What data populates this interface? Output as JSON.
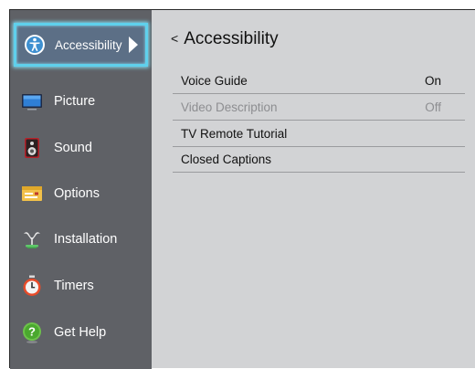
{
  "sidebar": {
    "items": [
      {
        "label": "Accessibility",
        "icon": "accessibility-icon",
        "selected": true
      },
      {
        "label": "Picture",
        "icon": "tv-screen-icon"
      },
      {
        "label": "Sound",
        "icon": "speaker-icon"
      },
      {
        "label": "Options",
        "icon": "options-icon"
      },
      {
        "label": "Installation",
        "icon": "antenna-icon"
      },
      {
        "label": "Timers",
        "icon": "stopwatch-icon"
      },
      {
        "label": "Get Help",
        "icon": "help-icon"
      }
    ]
  },
  "content": {
    "back_glyph": "<",
    "title": "Accessibility",
    "rows": [
      {
        "label": "Voice Guide",
        "value": "On"
      },
      {
        "label": "Video Description",
        "value": "Off",
        "disabled": true
      },
      {
        "label": "TV Remote Tutorial",
        "value": ""
      },
      {
        "label": "Closed Captions",
        "value": ""
      }
    ]
  },
  "colors": {
    "sidebar_bg": "#5f6166",
    "content_bg": "#d2d3d5",
    "selection_glow": "#5fd0ec"
  }
}
